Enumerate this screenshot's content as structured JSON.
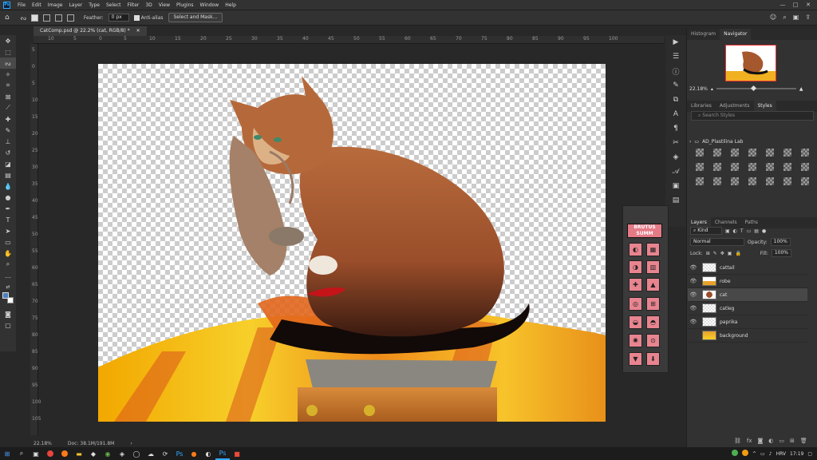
{
  "menu": [
    "File",
    "Edit",
    "Image",
    "Layer",
    "Type",
    "Select",
    "Filter",
    "3D",
    "View",
    "Plugins",
    "Window",
    "Help"
  ],
  "options": {
    "feather_label": "Feather:",
    "feather_value": "0 px",
    "antialias_label": "Anti-alias",
    "select_mask": "Select and Mask..."
  },
  "document": {
    "tab_title": "CatComp.psd @ 22.2% (cat, RGB/8) *",
    "ruler_h": [
      "10",
      "5",
      "0",
      "5",
      "10",
      "15",
      "20",
      "25",
      "30",
      "35",
      "40",
      "45",
      "50",
      "55",
      "60",
      "65",
      "70",
      "75",
      "80",
      "85",
      "90",
      "95",
      "100"
    ],
    "ruler_v": [
      "5",
      "0",
      "5",
      "10",
      "15",
      "20",
      "25",
      "30",
      "35",
      "40",
      "45",
      "50",
      "55",
      "60",
      "65",
      "70",
      "75",
      "80",
      "85",
      "90",
      "95",
      "100",
      "105"
    ]
  },
  "status": {
    "zoom": "22.18%",
    "doc": "Doc: 38.1M/191.8M",
    "arrow": "›"
  },
  "navigator": {
    "tabs": [
      "Histogram",
      "Navigator"
    ],
    "zoom": "22.18%"
  },
  "styles_panel": {
    "tabs": [
      "Libraries",
      "Adjustments",
      "Styles"
    ],
    "search_placeholder": "Search Styles",
    "folder": "AD_Plastilina Lab"
  },
  "float_panel": {
    "brutus": "BRUTUS SUMM"
  },
  "layers_panel": {
    "tabs": [
      "Layers",
      "Channels",
      "Paths"
    ],
    "kind": "Kind",
    "blend": "Normal",
    "opacity_label": "Opacity:",
    "opacity": "100%",
    "lock_label": "Lock:",
    "fill_label": "Fill:",
    "fill": "100%",
    "layers": [
      {
        "name": "cattail",
        "visible": true,
        "selected": false
      },
      {
        "name": "robe",
        "visible": true,
        "selected": false
      },
      {
        "name": "cat",
        "visible": true,
        "selected": true
      },
      {
        "name": "catleg",
        "visible": true,
        "selected": false
      },
      {
        "name": "paprika",
        "visible": true,
        "selected": false
      },
      {
        "name": "background",
        "visible": false,
        "selected": false
      }
    ]
  },
  "taskbar": {
    "lang": "HRV",
    "time": "17:19"
  },
  "colors": {
    "accent": "#31a8ff",
    "panel": "#323232",
    "floatbtn": "#e8848f"
  }
}
